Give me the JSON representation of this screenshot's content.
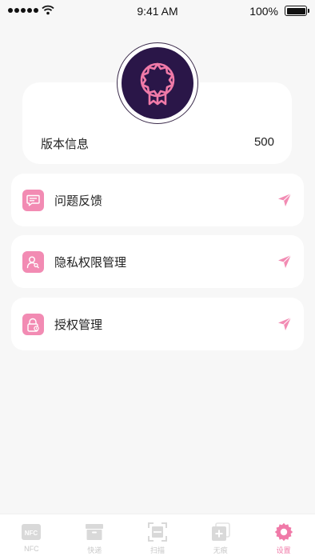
{
  "status_bar": {
    "time": "9:41 AM",
    "battery": "100%"
  },
  "version": {
    "label": "版本信息",
    "value": "500"
  },
  "menu": [
    {
      "label": "问题反馈",
      "icon": "message-icon"
    },
    {
      "label": "隐私权限管理",
      "icon": "user-key-icon"
    },
    {
      "label": "授权管理",
      "icon": "lock-icon"
    }
  ],
  "tabs": [
    {
      "label": "NFC",
      "icon": "nfc-icon",
      "active": false
    },
    {
      "label": "快递",
      "icon": "box-icon",
      "active": false
    },
    {
      "label": "扫描",
      "icon": "scan-icon",
      "active": false
    },
    {
      "label": "无痕",
      "icon": "add-card-icon",
      "active": false
    },
    {
      "label": "设置",
      "icon": "gear-icon",
      "active": true
    }
  ],
  "colors": {
    "accent": "#f28bb3",
    "badge_bg": "#2a1648",
    "badge_line": "#f07aa8",
    "inactive": "#c8c8c8"
  }
}
